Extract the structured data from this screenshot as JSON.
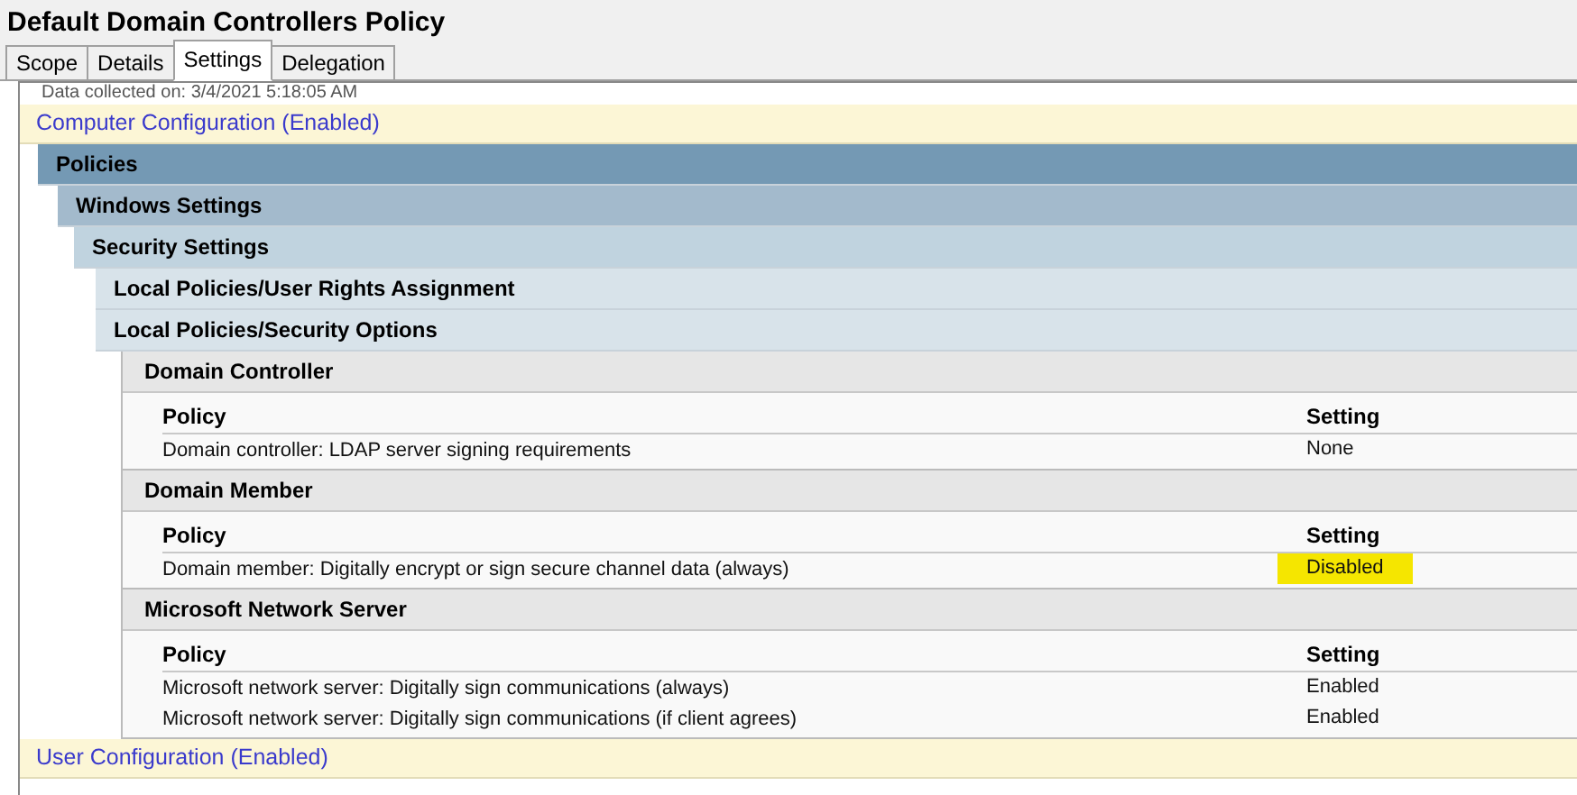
{
  "window": {
    "title": "Default Domain Controllers Policy"
  },
  "tabs": [
    {
      "label": "Scope",
      "selected": false
    },
    {
      "label": "Details",
      "selected": false
    },
    {
      "label": "Settings",
      "selected": true
    },
    {
      "label": "Delegation",
      "selected": false
    }
  ],
  "data_collected": "Data collected on: 3/4/2021 5:18:05 AM",
  "configurations": [
    {
      "title": "Computer Configuration (Enabled)",
      "children": [
        {
          "title": "Policies",
          "children": [
            {
              "title": "Windows Settings",
              "children": [
                {
                  "title": "Security Settings",
                  "children": [
                    {
                      "title": "Local Policies/User Rights Assignment"
                    },
                    {
                      "title": "Local Policies/Security Options",
                      "children": [
                        {
                          "title": "Domain Controller",
                          "columns": [
                            "Policy",
                            "Setting"
                          ],
                          "rows": [
                            {
                              "policy": "Domain controller: LDAP server signing requirements",
                              "setting": "None",
                              "highlighted": false
                            }
                          ]
                        },
                        {
                          "title": "Domain Member",
                          "columns": [
                            "Policy",
                            "Setting"
                          ],
                          "rows": [
                            {
                              "policy": "Domain member: Digitally encrypt or sign secure channel data (always)",
                              "setting": "Disabled",
                              "highlighted": true
                            }
                          ]
                        },
                        {
                          "title": "Microsoft Network Server",
                          "columns": [
                            "Policy",
                            "Setting"
                          ],
                          "rows": [
                            {
                              "policy": "Microsoft network server: Digitally sign communications (always)",
                              "setting": "Enabled",
                              "highlighted": false
                            },
                            {
                              "policy": "Microsoft network server: Digitally sign communications (if client agrees)",
                              "setting": "Enabled",
                              "highlighted": false
                            }
                          ]
                        }
                      ]
                    }
                  ]
                }
              ]
            }
          ]
        }
      ]
    },
    {
      "title": "User Configuration (Enabled)"
    }
  ]
}
